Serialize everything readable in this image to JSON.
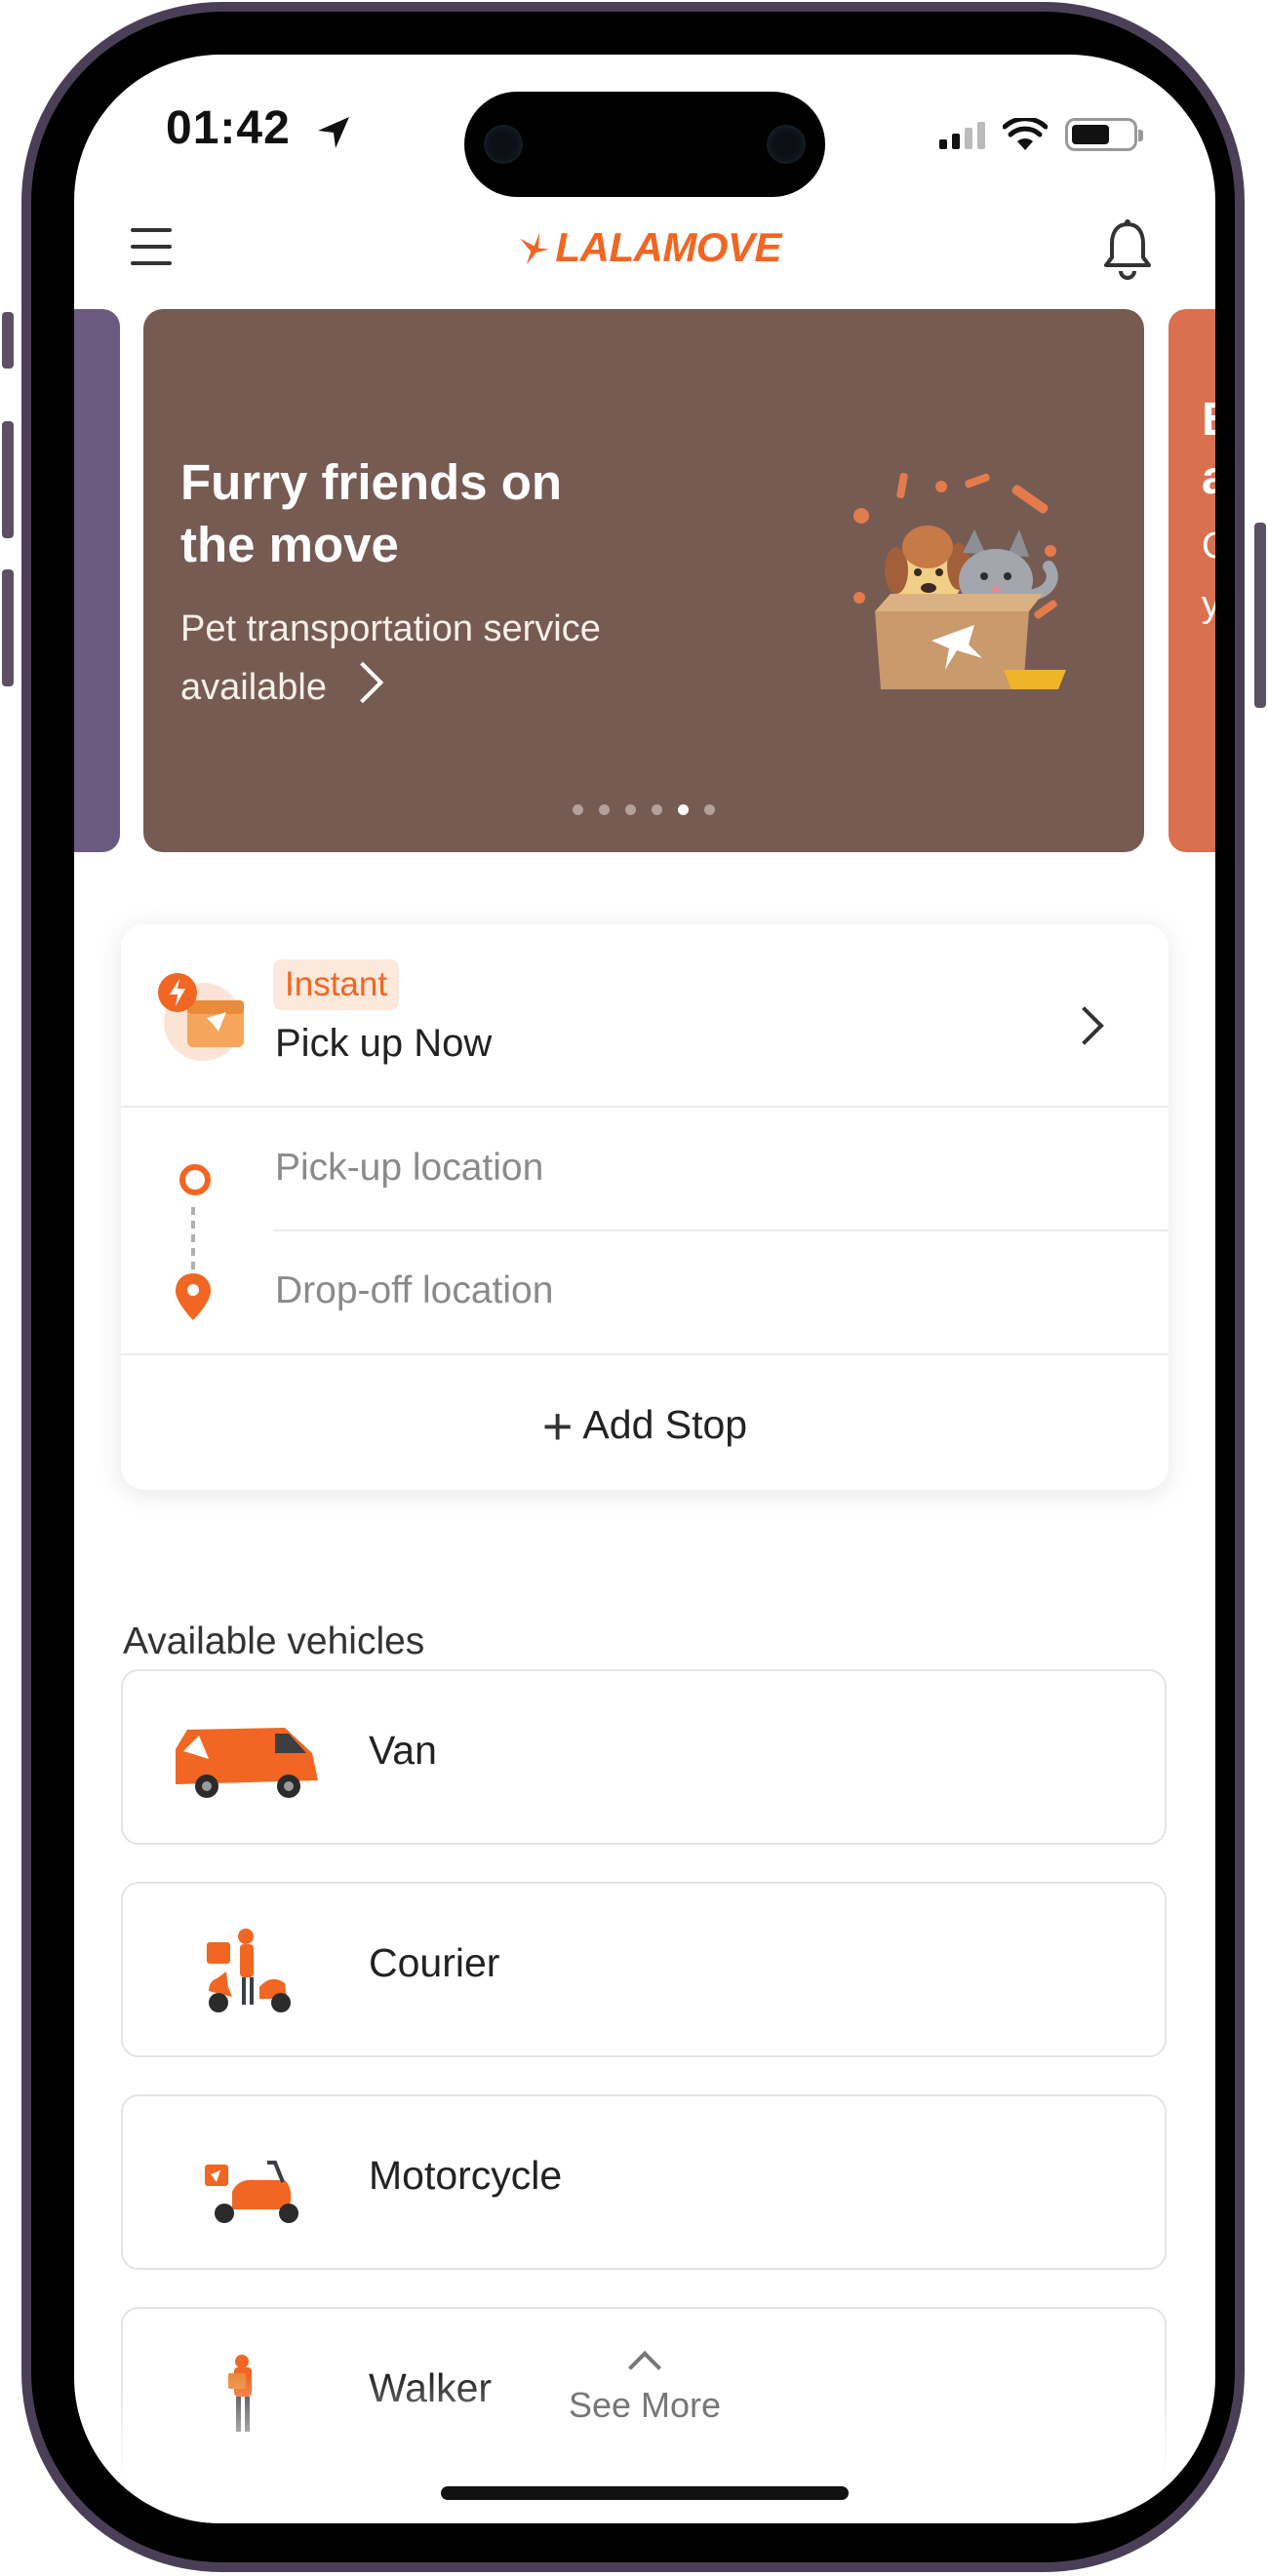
{
  "status_bar": {
    "time": "01:42"
  },
  "header": {
    "logo_text": "LALAMOVE"
  },
  "banner": {
    "title": "Furry friends on the move",
    "subtitle": "Pet transportation service available",
    "dot_count": 6,
    "active_dot": 4,
    "next_peek_letters": [
      "B",
      "a",
      "C",
      "y"
    ],
    "bg_color": "#765b53"
  },
  "order_card": {
    "badge": "Instant",
    "service": "Pick up Now",
    "pickup_placeholder": "Pick-up location",
    "dropoff_placeholder": "Drop-off location",
    "add_stop": "Add Stop"
  },
  "vehicles": {
    "title": "Available vehicles",
    "items": [
      {
        "label": "Van",
        "icon": "van-icon"
      },
      {
        "label": "Courier",
        "icon": "courier-icon"
      },
      {
        "label": "Motorcycle",
        "icon": "motorcycle-icon"
      },
      {
        "label": "Walker",
        "icon": "walker-icon"
      }
    ],
    "see_more": "See More"
  },
  "colors": {
    "brand": "#f16622",
    "badge_bg": "#fde8dc",
    "left_banner": "#6b5a80",
    "right_banner": "#d9704f"
  }
}
